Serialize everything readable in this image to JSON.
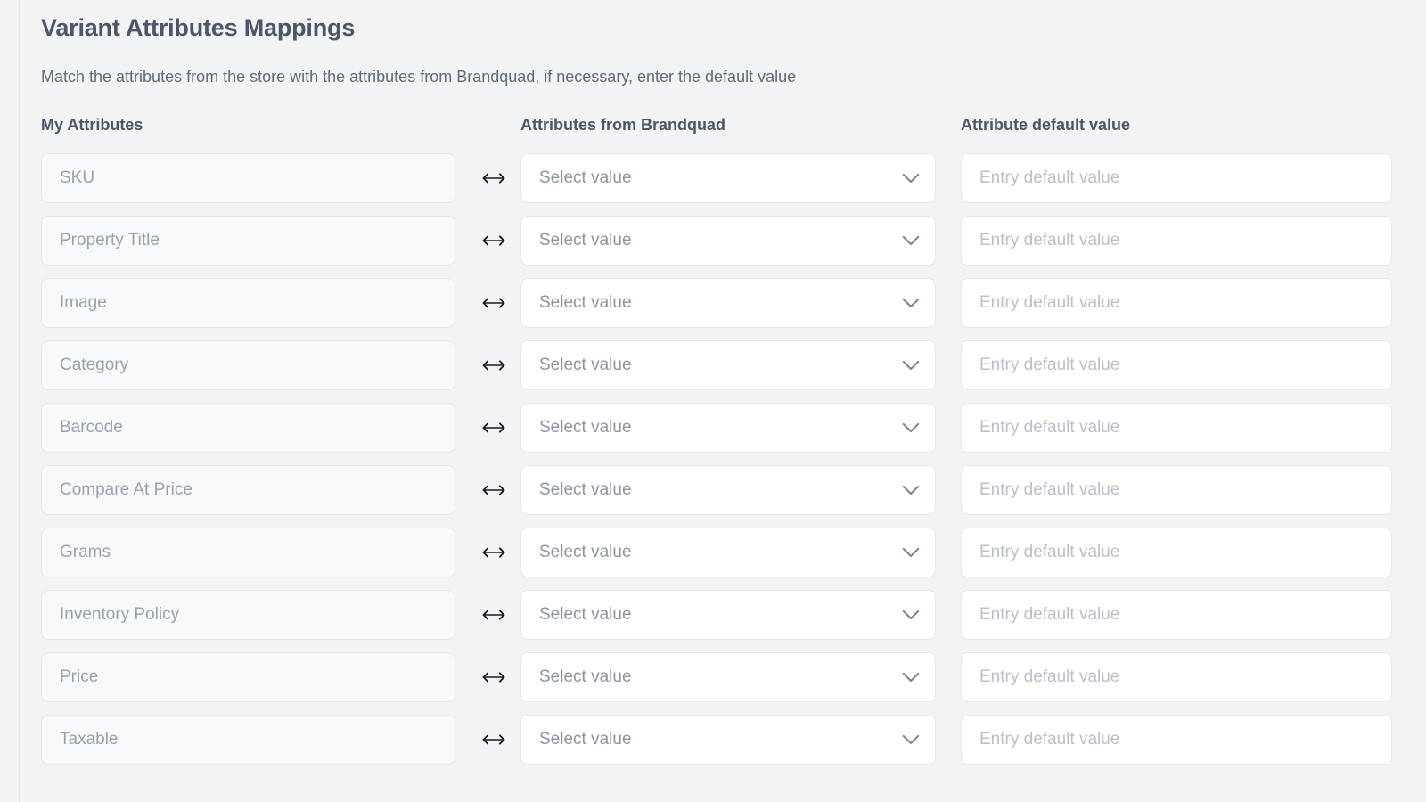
{
  "panel": {
    "title": "Variant Attributes Mappings",
    "subtitle": "Match the attributes from the store with the attributes from Brandquad, if necessary, enter the default value"
  },
  "columns": {
    "my_attributes": "My Attributes",
    "attributes_from_brandquad": "Attributes from Brandquad",
    "attribute_default_value": "Attribute default value"
  },
  "defaults": {
    "select_placeholder": "Select value",
    "default_value_placeholder": "Entry default value",
    "swap_icon": "swap-horizontal-icon",
    "chevron_icon": "chevron-down-icon"
  },
  "rows": [
    {
      "attribute": "SKU",
      "selected": "Select value",
      "default_value": "",
      "default_placeholder": "Entry default value"
    },
    {
      "attribute": "Property Title",
      "selected": "Select value",
      "default_value": "",
      "default_placeholder": "Entry default value"
    },
    {
      "attribute": "Image",
      "selected": "Select value",
      "default_value": "",
      "default_placeholder": "Entry default value"
    },
    {
      "attribute": "Category",
      "selected": "Select value",
      "default_value": "",
      "default_placeholder": "Entry default value"
    },
    {
      "attribute": "Barcode",
      "selected": "Select value",
      "default_value": "",
      "default_placeholder": "Entry default value"
    },
    {
      "attribute": "Compare At Price",
      "selected": "Select value",
      "default_value": "",
      "default_placeholder": "Entry default value"
    },
    {
      "attribute": "Grams",
      "selected": "Select value",
      "default_value": "",
      "default_placeholder": "Entry default value"
    },
    {
      "attribute": "Inventory Policy",
      "selected": "Select value",
      "default_value": "",
      "default_placeholder": "Entry default value"
    },
    {
      "attribute": "Price",
      "selected": "Select value",
      "default_value": "",
      "default_placeholder": "Entry default value"
    },
    {
      "attribute": "Taxable",
      "selected": "Select value",
      "default_value": "",
      "default_placeholder": "Entry default value"
    }
  ],
  "colors": {
    "background": "#f1f3f5",
    "field_readonly_bg": "#f8f9fa",
    "field_bg": "#ffffff",
    "border": "#e4e7eb",
    "heading_text": "#4c5666",
    "body_text": "#616b79",
    "placeholder_text": "#99a1ad",
    "swap_icon": "#151b23",
    "chevron_icon": "#7c8794"
  }
}
